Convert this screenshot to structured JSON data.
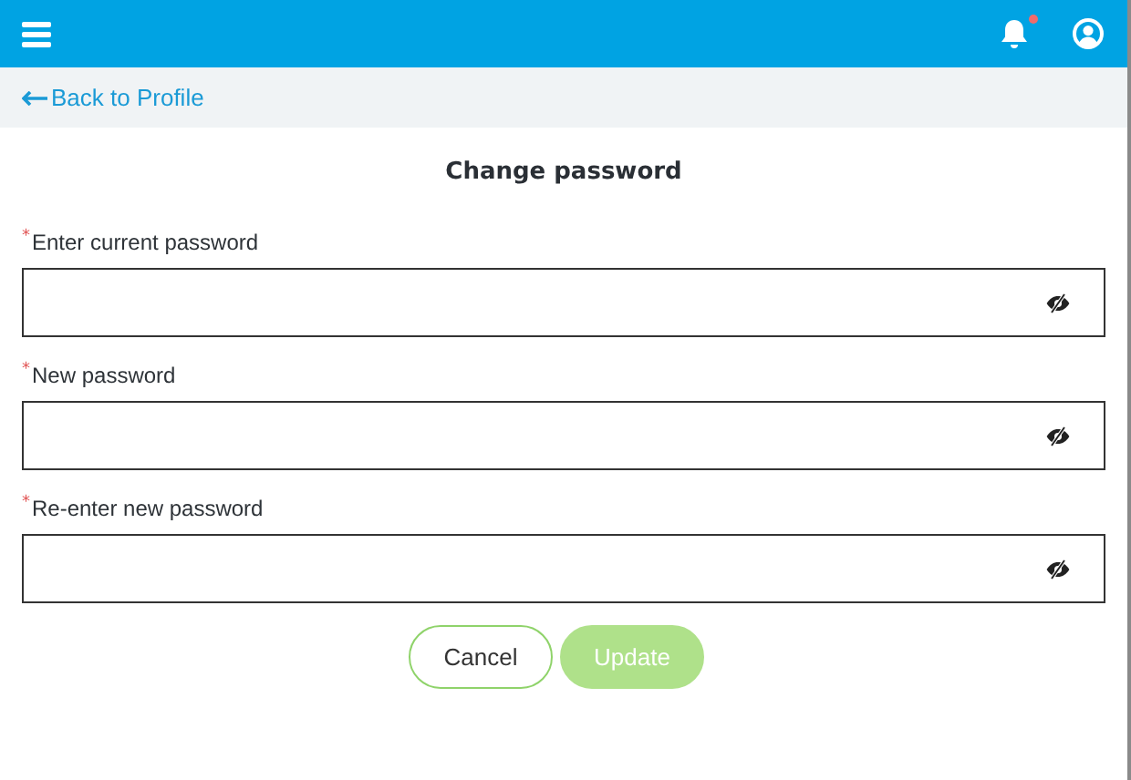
{
  "header": {
    "has_notification": true
  },
  "back_link": {
    "label": "Back to Profile"
  },
  "title": "Change password",
  "fields": [
    {
      "required_mark": "*",
      "label": "Enter current password"
    },
    {
      "required_mark": "*",
      "label": "New password"
    },
    {
      "required_mark": "*",
      "label": "Re-enter new password"
    }
  ],
  "buttons": [
    {
      "kind": "secondary",
      "label": "Cancel",
      "disabled": false
    },
    {
      "kind": "primary",
      "label": "Update",
      "disabled": true
    }
  ]
}
